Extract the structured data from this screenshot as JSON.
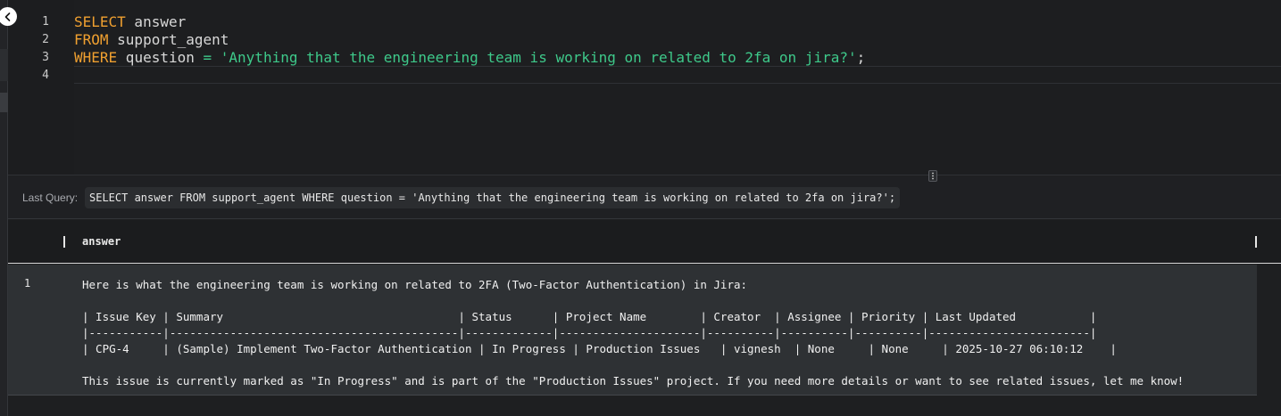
{
  "editor": {
    "line_numbers": [
      "1",
      "2",
      "3",
      "4"
    ],
    "lines": {
      "l1_kw": "SELECT",
      "l1_rest": " answer",
      "l2_kw": "FROM",
      "l2_rest": " support_agent",
      "l3_kw": "WHERE",
      "l3_ident": " question ",
      "l3_op": "=",
      "l3_str": " 'Anything that the engineering team is working on related to 2fa on jira?'",
      "l3_end": ";"
    }
  },
  "last_query": {
    "label": "Last Query:",
    "value": "SELECT answer FROM support_agent WHERE question = 'Anything that the engineering team is working on related to 2fa on jira?';"
  },
  "results": {
    "columns": [
      "answer"
    ],
    "rows": [
      {
        "index": "1",
        "answer": "Here is what the engineering team is working on related to 2FA (Two-Factor Authentication) in Jira:\n\n| Issue Key | Summary                                   | Status      | Project Name        | Creator  | Assignee | Priority | Last Updated           |\n|-----------|-------------------------------------------|-------------|---------------------|----------|----------|----------|------------------------|\n| CPG-4     | (Sample) Implement Two-Factor Authentication | In Progress | Production Issues   | vignesh  | None     | None     | 2025-10-27 06:10:12    |\n\nThis issue is currently marked as \"In Progress\" and is part of the \"Production Issues\" project. If you need more details or want to see related issues, let me know!"
      }
    ]
  },
  "icons": {
    "collapse": "chevron-left-icon",
    "resize": "drag-handle-icon"
  },
  "colors": {
    "keyword": "#f0a030",
    "string": "#3ec98a",
    "background": "#1e1f21"
  }
}
